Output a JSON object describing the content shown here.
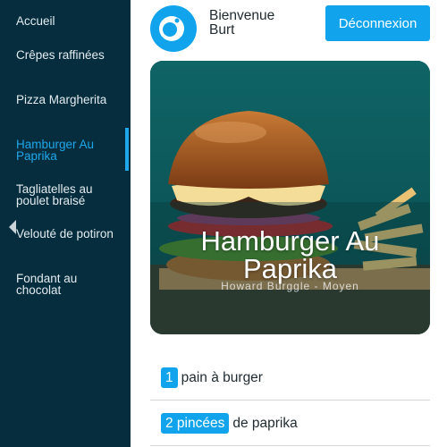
{
  "sidebar": {
    "items": [
      {
        "label": "Accueil"
      },
      {
        "label": "Crêpes raffinées"
      },
      {
        "label": "Pizza Margherita"
      },
      {
        "label": "Hamburger Au Paprika"
      },
      {
        "label": "Tagliatelles au poulet braisé"
      },
      {
        "label": "Velouté de potiron"
      },
      {
        "label": "Fondant au chocolat"
      }
    ],
    "active_index": 3,
    "toggle_icon": "chevron-left-icon"
  },
  "header": {
    "welcome": "Bienvenue Burt",
    "logout_label": "Déconnexion",
    "logo_icon": "logo-icon"
  },
  "recipe": {
    "title": "Hamburger Au Paprika",
    "subtitle": "Howard Burggle - Moyen",
    "ingredients": [
      {
        "qty": "1",
        "name": "pain à burger"
      },
      {
        "qty": "2 pincées",
        "name": "de paprika"
      }
    ]
  },
  "colors": {
    "sidebar_bg": "#052d3e",
    "accent": "#11a4ec",
    "active_text": "#1ea7ea"
  }
}
